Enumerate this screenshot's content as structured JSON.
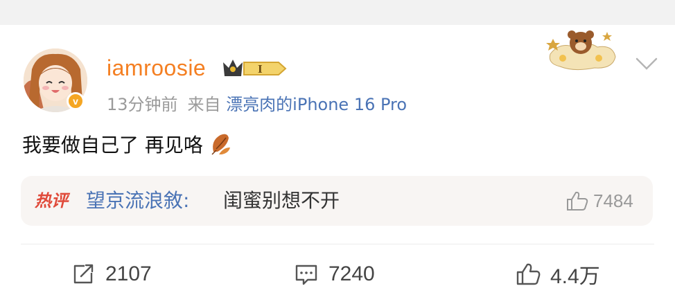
{
  "post": {
    "username": "iamroosie",
    "vip_level": "I",
    "time": "13分钟前",
    "source_prefix": "来自",
    "source": "漂亮肉的iPhone 16 Pro",
    "text": "我要做自己了 再见咯",
    "verified_mark": "v"
  },
  "hot_comment": {
    "tag": "热评",
    "author": "望京流浪敘",
    "separator": ":",
    "content": "闺蜜别想不开",
    "likes": "7484"
  },
  "actions": {
    "repost_count": "2107",
    "comment_count": "7240",
    "like_count": "4.4万"
  },
  "colors": {
    "username": "#f47f22",
    "link": "#4a73b5",
    "hot_tag": "#e04a3a",
    "vip_gold": "#e8b830"
  },
  "icons": [
    "crown-vip-icon",
    "chevron-down-icon",
    "leaf-emoji-icon",
    "thumb-up-icon",
    "repost-icon",
    "comment-icon",
    "like-icon"
  ]
}
